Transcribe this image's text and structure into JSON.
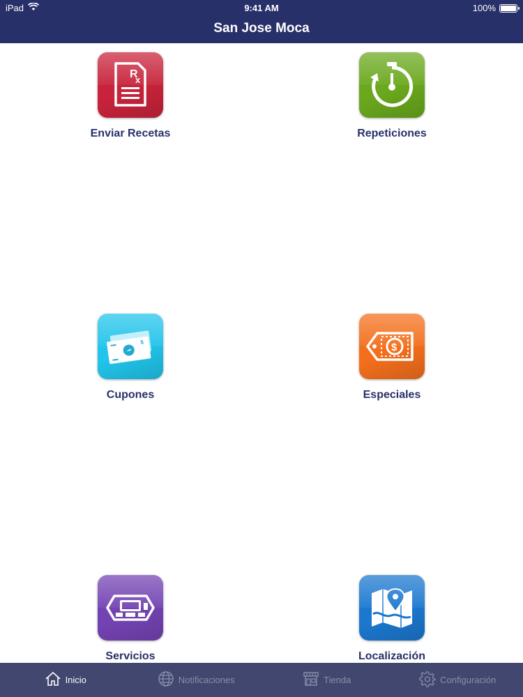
{
  "status_bar": {
    "device": "iPad",
    "time": "9:41 AM",
    "battery": "100%",
    "battery_level": 1.0
  },
  "nav": {
    "title": "San Jose Moca"
  },
  "grid": [
    {
      "label": "Enviar Recetas",
      "icon": "prescription-icon",
      "color": "#c8233b"
    },
    {
      "label": "Repeticiones",
      "icon": "refill-timer-icon",
      "color": "#6aa81d"
    },
    {
      "label": "Cupones",
      "icon": "coupon-bills-icon",
      "color": "#21c4ea"
    },
    {
      "label": "Especiales",
      "icon": "price-tag-icon",
      "color": "#f36f1c"
    },
    {
      "label": "Servicios",
      "icon": "services-icon",
      "color": "#7443b3"
    },
    {
      "label": "Localización",
      "icon": "map-pin-icon",
      "color": "#1b78cf"
    }
  ],
  "tabbar": {
    "tabs": [
      {
        "label": "Inicio",
        "icon": "home-icon",
        "active": true
      },
      {
        "label": "Notificaciones",
        "icon": "globe-icon",
        "active": false
      },
      {
        "label": "Tienda",
        "icon": "store-icon",
        "active": false
      },
      {
        "label": "Configuración",
        "icon": "gear-icon",
        "active": false
      }
    ]
  },
  "colors": {
    "header": "#28306a",
    "tabbar": "#41476f",
    "label": "#28306a"
  }
}
